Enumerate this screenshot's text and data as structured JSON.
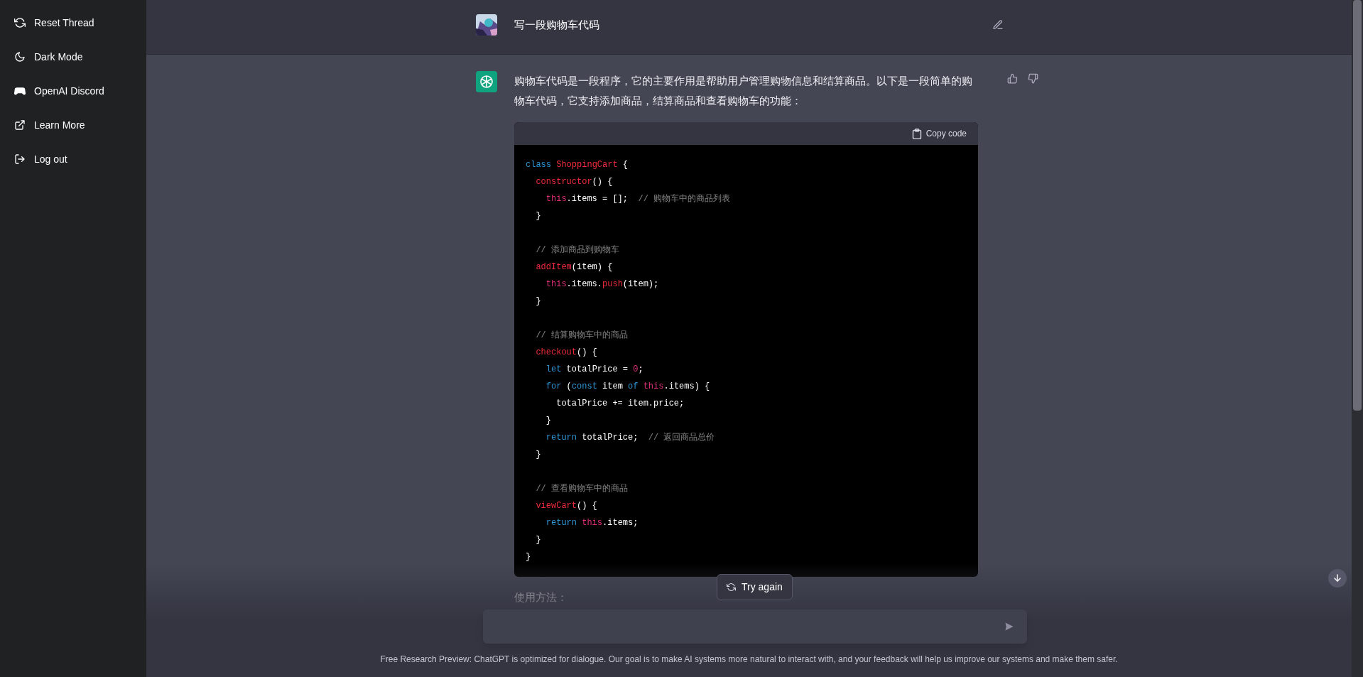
{
  "sidebar": {
    "items": [
      {
        "kind": "refresh",
        "label": "Reset Thread"
      },
      {
        "kind": "moon",
        "label": "Dark Mode"
      },
      {
        "kind": "controller",
        "label": "OpenAI Discord"
      },
      {
        "kind": "external",
        "label": "Learn More"
      },
      {
        "kind": "logout",
        "label": "Log out"
      }
    ]
  },
  "user_message": {
    "text": "写一段购物车代码"
  },
  "assistant_message": {
    "text": "购物车代码是一段程序，它的主要作用是帮助用户管理购物信息和结算商品。以下是一段简单的购物车代码，它支持添加商品，结算商品和查看购物车的功能：",
    "code": {
      "copy_button": "Copy code",
      "blocks": [
        [
          [
            {
              "kind": "keyword",
              "text": "class"
            },
            {
              "kind": "title",
              "text": " ShoppingCart"
            },
            {
              "kind": "plain",
              "text": " {"
            }
          ],
          [
            {
              "kind": "title",
              "text": "  constructor"
            },
            {
              "kind": "plain",
              "text": "() {"
            }
          ],
          [
            {
              "kind": "this",
              "text": "    this"
            },
            {
              "kind": "plain",
              "text": ".items = [];  "
            },
            {
              "kind": "comment",
              "text": "// 购物车中的商品列表"
            }
          ],
          [
            {
              "kind": "plain",
              "text": "  }"
            }
          ]
        ],
        [
          [
            {
              "kind": "comment",
              "text": "  // 添加商品到购物车"
            }
          ],
          [
            {
              "kind": "title",
              "text": "  addItem"
            },
            {
              "kind": "plain",
              "text": "(item) {"
            }
          ],
          [
            {
              "kind": "this",
              "text": "    this"
            },
            {
              "kind": "plain",
              "text": ".items."
            },
            {
              "kind": "title",
              "text": "push"
            },
            {
              "kind": "plain",
              "text": "(item);"
            }
          ],
          [
            {
              "kind": "plain",
              "text": "  }"
            }
          ]
        ],
        [
          [
            {
              "kind": "comment",
              "text": "  // 结算购物车中的商品"
            }
          ],
          [
            {
              "kind": "title",
              "text": "  checkout"
            },
            {
              "kind": "plain",
              "text": "() {"
            }
          ],
          [
            {
              "kind": "keyword",
              "text": "    let"
            },
            {
              "kind": "plain",
              "text": " totalPrice = "
            },
            {
              "kind": "number",
              "text": "0"
            },
            {
              "kind": "plain",
              "text": ";"
            }
          ],
          [
            {
              "kind": "keyword",
              "text": "    for"
            },
            {
              "kind": "plain",
              "text": " ("
            },
            {
              "kind": "keyword",
              "text": "const"
            },
            {
              "kind": "plain",
              "text": " item "
            },
            {
              "kind": "keyword",
              "text": "of"
            },
            {
              "kind": "this",
              "text": " this"
            },
            {
              "kind": "plain",
              "text": ".items) {"
            }
          ],
          [
            {
              "kind": "plain",
              "text": "      totalPrice += item.price;"
            }
          ],
          [
            {
              "kind": "plain",
              "text": "    }"
            }
          ],
          [
            {
              "kind": "keyword",
              "text": "    return"
            },
            {
              "kind": "plain",
              "text": " totalPrice;  "
            },
            {
              "kind": "comment",
              "text": "// 返回商品总价"
            }
          ],
          [
            {
              "kind": "plain",
              "text": "  }"
            }
          ]
        ],
        [
          [
            {
              "kind": "comment",
              "text": "  // 查看购物车中的商品"
            }
          ],
          [
            {
              "kind": "title",
              "text": "  viewCart"
            },
            {
              "kind": "plain",
              "text": "() {"
            }
          ],
          [
            {
              "kind": "keyword",
              "text": "    return"
            },
            {
              "kind": "this",
              "text": " this"
            },
            {
              "kind": "plain",
              "text": ".items;"
            }
          ],
          [
            {
              "kind": "plain",
              "text": "  }"
            }
          ],
          [
            {
              "kind": "plain",
              "text": "}"
            }
          ]
        ]
      ]
    },
    "after_text": "使用方法："
  },
  "try_again_button": "Try again",
  "footer": "Free Research Preview: ChatGPT is optimized for dialogue. Our goal is to make AI systems more natural to interact with, and your feedback will help us improve our systems and make them safer."
}
